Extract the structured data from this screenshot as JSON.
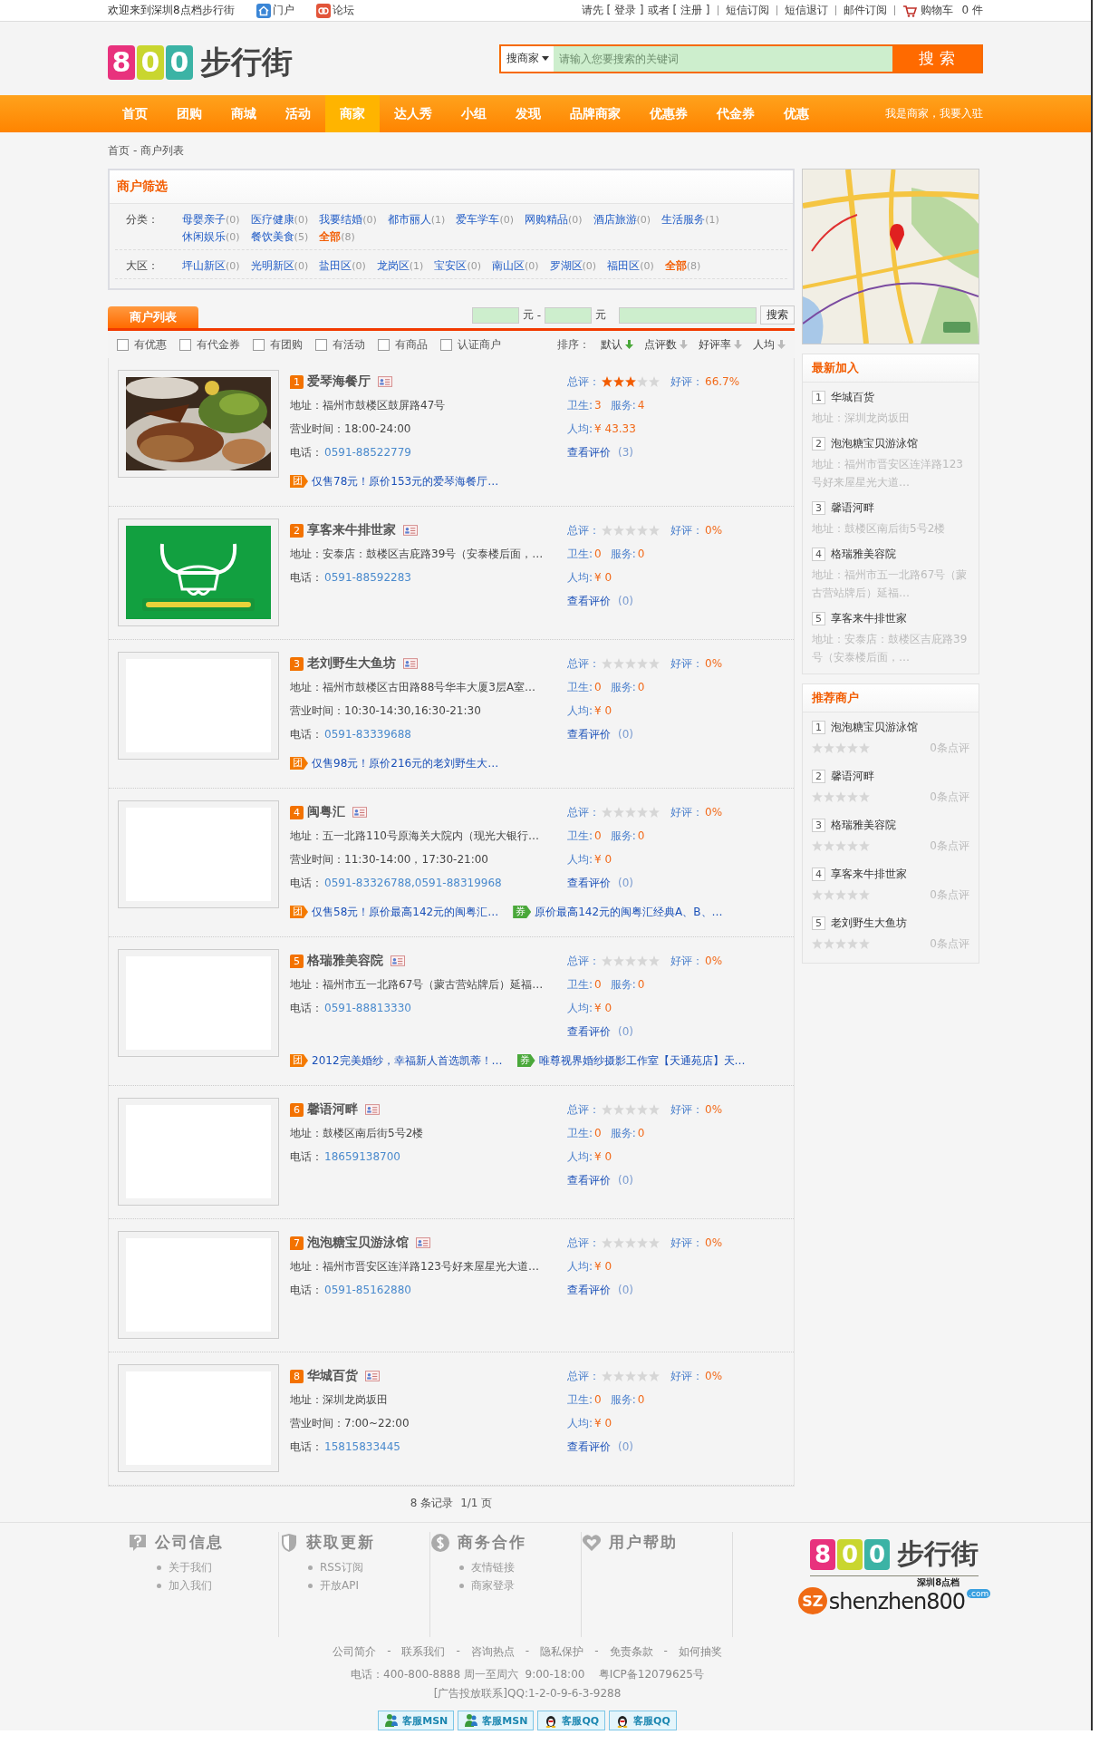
{
  "top_bar": {
    "welcome": "欢迎来到深圳8点档步行街",
    "portal_links": [
      {
        "kind": "home",
        "label": "门户"
      },
      {
        "kind": "forum",
        "label": "论坛"
      }
    ],
    "login_prompt": "请先",
    "login": "[ 登录 ]",
    "or": "或者",
    "register": "[ 注册 ]",
    "links": [
      "短信订阅",
      "短信退订",
      "邮件订阅"
    ],
    "cart": "购物车",
    "cart_count": "0 件"
  },
  "logo": {
    "digits": [
      "8",
      "0",
      "0"
    ],
    "text": "步行街"
  },
  "search": {
    "scope": "搜商家",
    "placeholder": "请输入您要搜索的关键词",
    "button": "搜 索"
  },
  "nav": {
    "items": [
      {
        "label": "首页",
        "selected": false
      },
      {
        "label": "团购",
        "selected": false
      },
      {
        "label": "商城",
        "selected": false
      },
      {
        "label": "活动",
        "selected": false
      },
      {
        "label": "商家",
        "selected": true
      },
      {
        "label": "达人秀",
        "selected": false
      },
      {
        "label": "小组",
        "selected": false
      },
      {
        "label": "发现",
        "selected": false
      },
      {
        "label": "品牌商家",
        "selected": false
      },
      {
        "label": "优惠券",
        "selected": false
      },
      {
        "label": "代金券",
        "selected": false
      },
      {
        "label": "优惠",
        "selected": false
      }
    ],
    "merchant_join": "我是商家，我要入驻"
  },
  "breadcrumb": {
    "home": "首页",
    "current": "- 商户列表"
  },
  "filter": {
    "title": "商户筛选",
    "rows": [
      {
        "label": "分类：",
        "options": [
          {
            "name": "母婴亲子",
            "count": "(0)",
            "selected": false
          },
          {
            "name": "医疗健康",
            "count": "(0)",
            "selected": false
          },
          {
            "name": "我要结婚",
            "count": "(0)",
            "selected": false
          },
          {
            "name": "都市丽人",
            "count": "(1)",
            "selected": false
          },
          {
            "name": "爱车学车",
            "count": "(0)",
            "selected": false
          },
          {
            "name": "网购精品",
            "count": "(0)",
            "selected": false
          },
          {
            "name": "酒店旅游",
            "count": "(0)",
            "selected": false
          },
          {
            "name": "生活服务",
            "count": "(1)",
            "selected": false
          },
          {
            "name": "休闲娱乐",
            "count": "(0)",
            "selected": false
          },
          {
            "name": "餐饮美食",
            "count": "(5)",
            "selected": false
          },
          {
            "name": "全部",
            "count": "(8)",
            "selected": true
          }
        ]
      },
      {
        "label": "大区：",
        "options": [
          {
            "name": "坪山新区",
            "count": "(0)",
            "selected": false
          },
          {
            "name": "光明新区",
            "count": "(0)",
            "selected": false
          },
          {
            "name": "盐田区",
            "count": "(0)",
            "selected": false
          },
          {
            "name": "龙岗区",
            "count": "(1)",
            "selected": false
          },
          {
            "name": "宝安区",
            "count": "(0)",
            "selected": false
          },
          {
            "name": "南山区",
            "count": "(0)",
            "selected": false
          },
          {
            "name": "罗湖区",
            "count": "(0)",
            "selected": false
          },
          {
            "name": "福田区",
            "count": "(0)",
            "selected": false
          },
          {
            "name": "全部",
            "count": "(8)",
            "selected": true
          }
        ]
      }
    ]
  },
  "tabs": [
    {
      "label": "商户列表",
      "selected": true
    }
  ],
  "price_filter": {
    "unit_1": "元",
    "dash": "-",
    "unit_2": "元",
    "button": "搜索"
  },
  "checkboxes": [
    {
      "label": "有优惠",
      "checked": false
    },
    {
      "label": "有代金券",
      "checked": false
    },
    {
      "label": "有团购",
      "checked": false
    },
    {
      "label": "有活动",
      "checked": false
    },
    {
      "label": "有商品",
      "checked": false
    },
    {
      "label": "认证商户",
      "checked": false
    }
  ],
  "sort": {
    "label": "排序：",
    "options": [
      {
        "label": "默认",
        "selected": true
      },
      {
        "label": "点评数",
        "selected": false
      },
      {
        "label": "好评率",
        "selected": false
      },
      {
        "label": "人均",
        "selected": false
      }
    ]
  },
  "merchants": [
    {
      "index": "1",
      "name": "爱琴海餐厅",
      "address": [
        "地址：",
        "福州市鼓楼区鼓屏路47号"
      ],
      "hours": [
        "营业时间：",
        "18:00-24:00"
      ],
      "phone": [
        "电话：",
        "0591-88522779"
      ],
      "deals": [
        {
          "kind": "group",
          "badge": "团",
          "text": "仅售78元！原价153元的爱琴海餐厅…"
        }
      ],
      "score_label": "总评：",
      "stars": 3,
      "good": [
        "好评：",
        "66.7%"
      ],
      "hygiene": [
        "卫生:",
        "3"
      ],
      "service": [
        "服务:",
        "4"
      ],
      "avg": [
        "人均:",
        "¥ 43.33"
      ],
      "reviews": [
        "查看评价",
        "(3)"
      ]
    },
    {
      "index": "2",
      "name": "享客来牛排世家",
      "kind": "logo",
      "address": [
        "地址：",
        "安泰店：鼓楼区吉庇路39号（安泰楼后面，…"
      ],
      "phone": [
        "电话：",
        "0591-88592283"
      ],
      "score_label": "总评：",
      "stars": 0,
      "good": [
        "好评：",
        "0%"
      ],
      "hygiene": [
        "卫生:",
        "0"
      ],
      "service": [
        "服务:",
        "0"
      ],
      "avg": [
        "人均:",
        "¥ 0"
      ],
      "reviews": [
        "查看评价",
        "(0)"
      ]
    },
    {
      "index": "3",
      "name": "老刘野生大鱼坊",
      "kind": "blank",
      "address": [
        "地址：",
        "福州市鼓楼区古田路88号华丰大厦3层A室…"
      ],
      "hours": [
        "营业时间：",
        "10:30-14:30,16:30-21:30"
      ],
      "phone": [
        "电话：",
        "0591-83339688"
      ],
      "deals": [
        {
          "kind": "group",
          "badge": "团",
          "text": "仅售98元！原价216元的老刘野生大…"
        }
      ],
      "score_label": "总评：",
      "stars": 0,
      "good": [
        "好评：",
        "0%"
      ],
      "hygiene": [
        "卫生:",
        "0"
      ],
      "service": [
        "服务:",
        "0"
      ],
      "avg": [
        "人均:",
        "¥ 0"
      ],
      "reviews": [
        "查看评价",
        "(0)"
      ]
    },
    {
      "index": "4",
      "name": "闽粤汇",
      "kind": "blank",
      "address": [
        "地址：",
        "五一北路110号原海关大院内（现光大银行…"
      ],
      "hours": [
        "营业时间：",
        "11:30-14:00，17:30-21:00"
      ],
      "phone": [
        "电话：",
        "0591-83326788,0591-88319968"
      ],
      "deals": [
        {
          "kind": "group",
          "badge": "团",
          "text": "仅售58元！原价最高142元的闽粤汇…"
        },
        {
          "kind": "coupon",
          "badge": "券",
          "text": "原价最高142元的闽粤汇经典A、B、…"
        }
      ],
      "score_label": "总评：",
      "stars": 0,
      "good": [
        "好评：",
        "0%"
      ],
      "hygiene": [
        "卫生:",
        "0"
      ],
      "service": [
        "服务:",
        "0"
      ],
      "avg": [
        "人均:",
        "¥ 0"
      ],
      "reviews": [
        "查看评价",
        "(0)"
      ]
    },
    {
      "index": "5",
      "name": "格瑞雅美容院",
      "kind": "blank",
      "address": [
        "地址：",
        "福州市五一北路67号（蒙古营站牌后）延福…"
      ],
      "phone": [
        "电话：",
        "0591-88813330"
      ],
      "deals": [
        {
          "kind": "group",
          "badge": "团",
          "text": "2012完美婚纱，幸福新人首选凯蒂！…"
        },
        {
          "kind": "coupon",
          "badge": "券",
          "text": "唯尊视界婚纱摄影工作室【天通苑店】天…"
        }
      ],
      "score_label": "总评：",
      "stars": 0,
      "good": [
        "好评：",
        "0%"
      ],
      "hygiene": [
        "卫生:",
        "0"
      ],
      "service": [
        "服务:",
        "0"
      ],
      "avg": [
        "人均:",
        "¥ 0"
      ],
      "reviews": [
        "查看评价",
        "(0)"
      ]
    },
    {
      "index": "6",
      "name": "馨语河畔",
      "kind": "blank",
      "address": [
        "地址：",
        "鼓楼区南后街5号2楼"
      ],
      "phone": [
        "电话：",
        "18659138700"
      ],
      "score_label": "总评：",
      "stars": 0,
      "good": [
        "好评：",
        "0%"
      ],
      "hygiene": [
        "卫生:",
        "0"
      ],
      "service": [
        "服务:",
        "0"
      ],
      "avg": [
        "人均:",
        "¥ 0"
      ],
      "reviews": [
        "查看评价",
        "(0)"
      ]
    },
    {
      "index": "7",
      "name": "泡泡糖宝贝游泳馆",
      "kind": "blank",
      "address": [
        "地址：",
        "福州市晋安区连洋路123号好来屋星光大道…"
      ],
      "phone": [
        "电话：",
        "0591-85162880"
      ],
      "score_label": "总评：",
      "stars": 0,
      "good": [
        "好评：",
        "0%"
      ],
      "avg": [
        "人均:",
        "¥ 0"
      ],
      "reviews": [
        "查看评价",
        "(0)"
      ]
    },
    {
      "index": "8",
      "name": "华城百货",
      "kind": "blank",
      "address": [
        "地址：",
        "深圳龙岗坂田"
      ],
      "hours": [
        "营业时间：",
        "7:00~22:00"
      ],
      "phone": [
        "电话：",
        "15815833445"
      ],
      "score_label": "总评：",
      "stars": 0,
      "good": [
        "好评：",
        "0%"
      ],
      "hygiene": [
        "卫生:",
        "0"
      ],
      "service": [
        "服务:",
        "0"
      ],
      "avg": [
        "人均:",
        "¥ 0"
      ],
      "reviews": [
        "查看评价",
        "(0)"
      ]
    }
  ],
  "pagination": {
    "records": "8 条记录",
    "pages": "1/1 页"
  },
  "newest": {
    "title": "最新加入",
    "items": [
      {
        "index": "1",
        "name": "华城百货",
        "address": "地址：深圳龙岗坂田"
      },
      {
        "index": "2",
        "name": "泡泡糖宝贝游泳馆",
        "address": "地址：福州市晋安区连洋路123号好来屋星光大道…"
      },
      {
        "index": "3",
        "name": "馨语河畔",
        "address": "地址：鼓楼区南后街5号2楼"
      },
      {
        "index": "4",
        "name": "格瑞雅美容院",
        "address": "地址：福州市五一北路67号（蒙古营站牌后）延福…"
      },
      {
        "index": "5",
        "name": "享客来牛排世家",
        "address": "地址：安泰店：鼓楼区吉庇路39号（安泰楼后面，…"
      }
    ]
  },
  "recommended": {
    "title": "推荐商户",
    "items": [
      {
        "index": "1",
        "name": "泡泡糖宝贝游泳馆",
        "stars": 0,
        "reviews": "0条点评"
      },
      {
        "index": "2",
        "name": "馨语河畔",
        "stars": 0,
        "reviews": "0条点评"
      },
      {
        "index": "3",
        "name": "格瑞雅美容院",
        "stars": 0,
        "reviews": "0条点评"
      },
      {
        "index": "4",
        "name": "享客来牛排世家",
        "stars": 0,
        "reviews": "0条点评"
      },
      {
        "index": "5",
        "name": "老刘野生大鱼坊",
        "stars": 0,
        "reviews": "0条点评"
      }
    ]
  },
  "footer": {
    "columns": [
      {
        "kind": "question",
        "title": "公司信息",
        "links": [
          "关于我们",
          "加入我们"
        ]
      },
      {
        "kind": "shield",
        "title": "获取更新",
        "links": [
          "RSS订阅",
          "开放API"
        ]
      },
      {
        "kind": "dollar",
        "title": "商务合作",
        "links": [
          "友情链接",
          "商家登录"
        ]
      },
      {
        "kind": "heart",
        "title": "用户帮助"
      }
    ],
    "logo": {
      "digits": [
        "8",
        "0",
        "0"
      ],
      "text": "步行街",
      "tagline": "深圳8点档",
      "badge": "SZ",
      "site": "shenzhen800",
      "tld": ".com"
    },
    "links": [
      "公司简介",
      "联系我们",
      "咨询热点",
      "隐私保护",
      "免责条款",
      "如何抽奖"
    ],
    "link_separator": "-",
    "contact": "电话：400-800-8888 周一至周六  9:00-18:00    粤ICP备12079625号",
    "ads": "[广告投放联系]QQ:1-2-0-9-6-3-9288",
    "service_buttons": [
      {
        "kind": "msn",
        "label": "客服MSN"
      },
      {
        "kind": "msn",
        "label": "客服MSN"
      },
      {
        "kind": "qq",
        "label": "客服QQ"
      },
      {
        "kind": "qq",
        "label": "客服QQ"
      }
    ]
  }
}
